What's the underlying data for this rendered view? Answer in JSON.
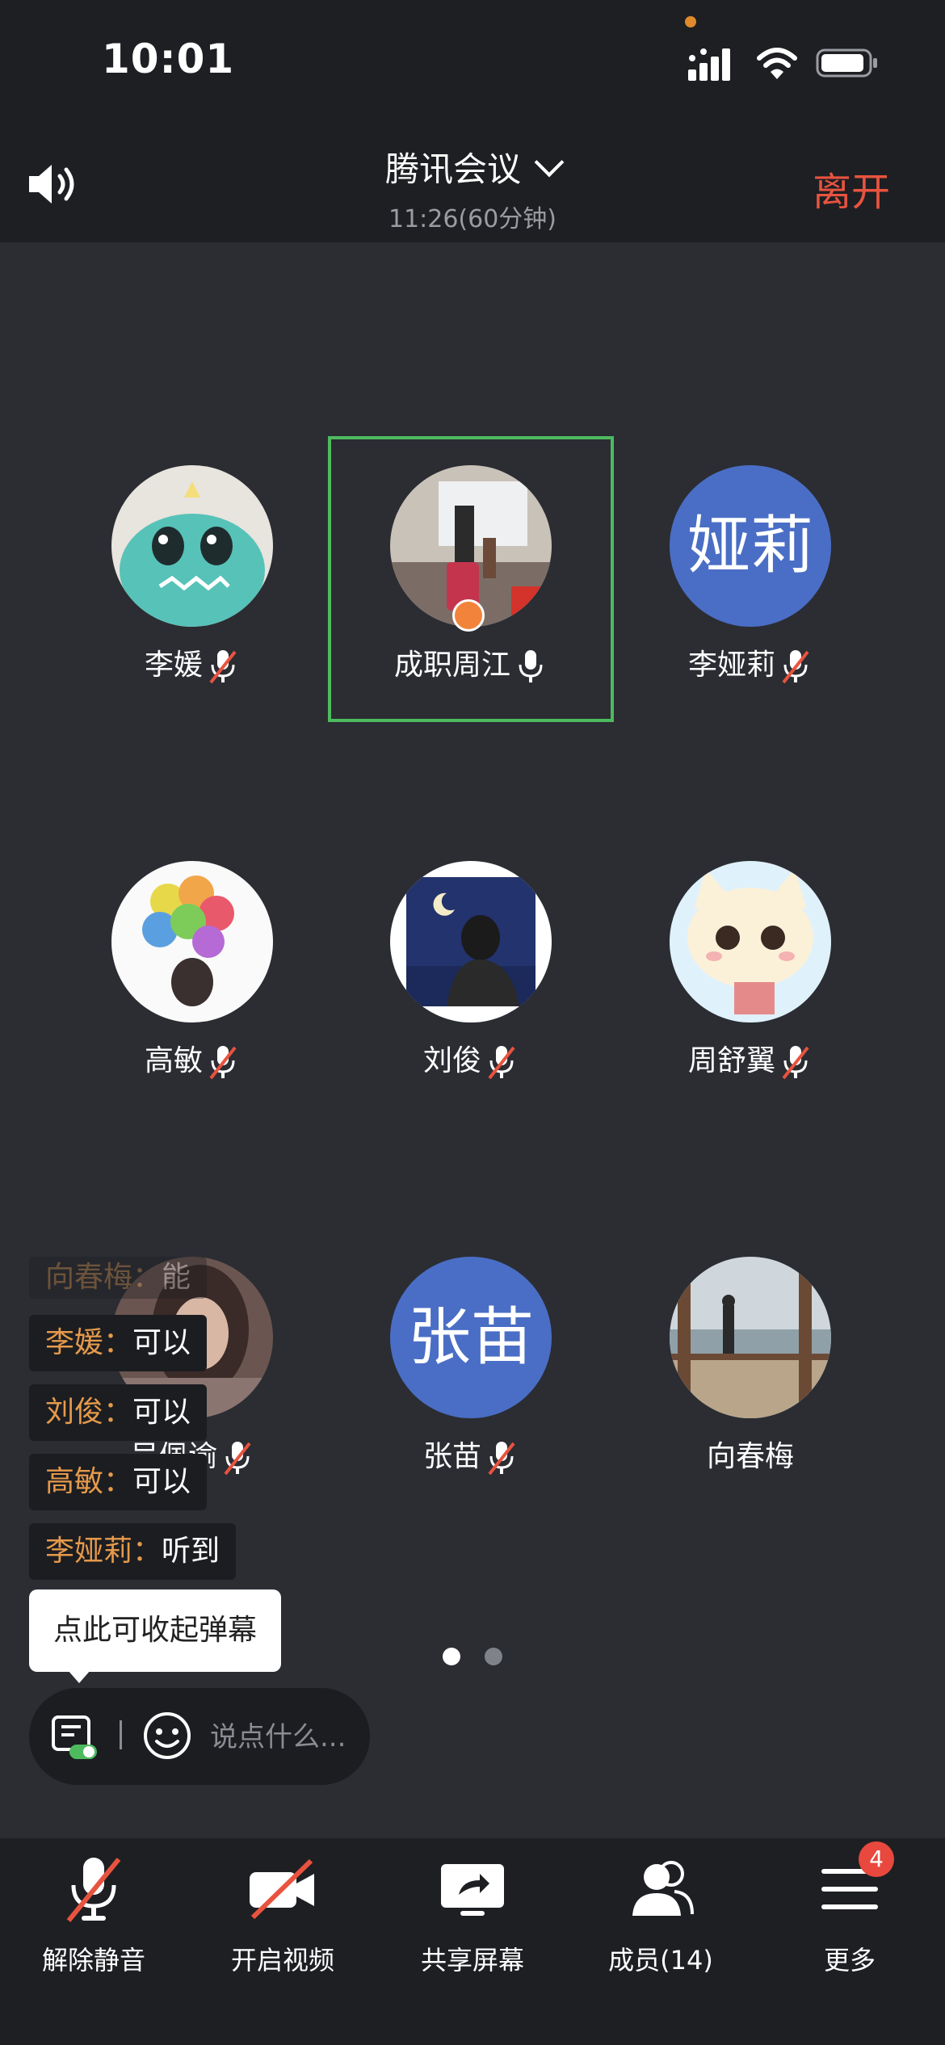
{
  "status_bar": {
    "time": "10:01"
  },
  "header": {
    "title": "腾讯会议",
    "subtitle": "11:26(60分钟)",
    "leave_label": "离开"
  },
  "participants": [
    {
      "name": "李媛",
      "mic": "muted",
      "avatar": "dinosaur-plush-photo"
    },
    {
      "name": "成职周江",
      "mic": "on",
      "avatar": "travel-photo",
      "speaking": true,
      "host": true
    },
    {
      "name": "李娅莉",
      "mic": "muted",
      "avatar_text": "娅莉",
      "avatar_color": "#4a6ec5"
    },
    {
      "name": "高敏",
      "mic": "muted",
      "avatar": "balloons-girl-illustration"
    },
    {
      "name": "刘俊",
      "mic": "muted",
      "avatar": "moon-boy-illustration"
    },
    {
      "name": "周舒翼",
      "mic": "muted",
      "avatar": "cartoon-cat"
    },
    {
      "name": "吴佩谕",
      "mic": "muted",
      "avatar": "portrait-photo"
    },
    {
      "name": "张苗",
      "mic": "muted",
      "avatar_text": "张苗",
      "avatar_color": "#4a6ec5"
    },
    {
      "name": "向春梅",
      "mic": "none",
      "avatar": "seaside-photo"
    }
  ],
  "danmu": [
    {
      "name": "向春梅",
      "sep": "：",
      "msg": "能"
    },
    {
      "name": "李媛",
      "sep": "：",
      "msg": "可以"
    },
    {
      "name": "刘俊",
      "sep": "：",
      "msg": "可以"
    },
    {
      "name": "高敏",
      "sep": "：",
      "msg": "可以"
    },
    {
      "name": "李娅莉",
      "sep": "：",
      "msg": "听到"
    }
  ],
  "tip": "点此可收起弹幕",
  "chat": {
    "placeholder": "说点什么..."
  },
  "pager": {
    "pages": 2,
    "current": 1
  },
  "toolbar": {
    "unmute": "解除静音",
    "video": "开启视频",
    "share": "共享屏幕",
    "members": "成员(14)",
    "more": "更多",
    "more_badge": "4"
  },
  "colors": {
    "accent_green": "#4dba5e",
    "leave_red": "#e8533f",
    "danmu_name": "#e59a4b",
    "avatar_blue": "#4a6ec5"
  }
}
